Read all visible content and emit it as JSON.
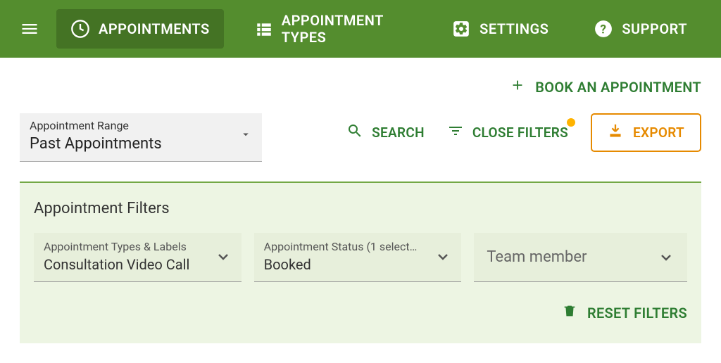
{
  "nav": {
    "items": [
      {
        "label": "APPOINTMENTS"
      },
      {
        "label": "APPOINTMENT TYPES"
      },
      {
        "label": "SETTINGS"
      },
      {
        "label": "SUPPORT"
      }
    ]
  },
  "book": {
    "label": "BOOK AN APPOINTMENT"
  },
  "range": {
    "label": "Appointment Range",
    "value": "Past Appointments"
  },
  "actions": {
    "search": "SEARCH",
    "close_filters": "CLOSE FILTERS",
    "export": "EXPORT"
  },
  "filters": {
    "title": "Appointment Filters",
    "types": {
      "label": "Appointment Types & Labels",
      "value": "Consultation Video Call"
    },
    "status": {
      "label": "Appointment Status (1 select…",
      "value": "Booked"
    },
    "team": {
      "placeholder": "Team member"
    },
    "reset": "RESET FILTERS"
  }
}
